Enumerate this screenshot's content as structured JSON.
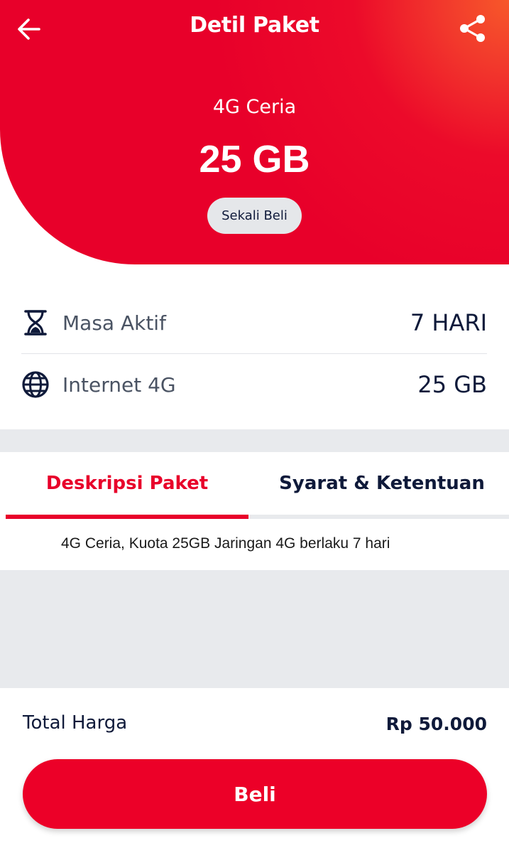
{
  "header": {
    "title": "Detil Paket",
    "back_icon": "arrow-left-icon",
    "share_icon": "share-icon",
    "package_name": "4G Ceria",
    "package_size": "25 GB",
    "badge": "Sekali Beli",
    "gradient_colors": [
      "#e8002a",
      "#f7582a"
    ]
  },
  "info": [
    {
      "icon": "hourglass-icon",
      "label": "Masa Aktif",
      "value": "7 HARI"
    },
    {
      "icon": "globe-icon",
      "label": "Internet 4G",
      "value": "25 GB"
    }
  ],
  "tabs": [
    {
      "label": "Deskripsi Paket",
      "active": true
    },
    {
      "label": "Syarat & Ketentuan",
      "active": false
    }
  ],
  "description": "4G Ceria, Kuota 25GB Jaringan 4G berlaku 7 hari",
  "footer": {
    "total_label": "Total Harga",
    "total_value": "Rp 50.000",
    "buy_label": "Beli"
  },
  "colors": {
    "primary": "#e8002a",
    "text_dark": "#0f1a3a",
    "band": "#e8eaed"
  }
}
